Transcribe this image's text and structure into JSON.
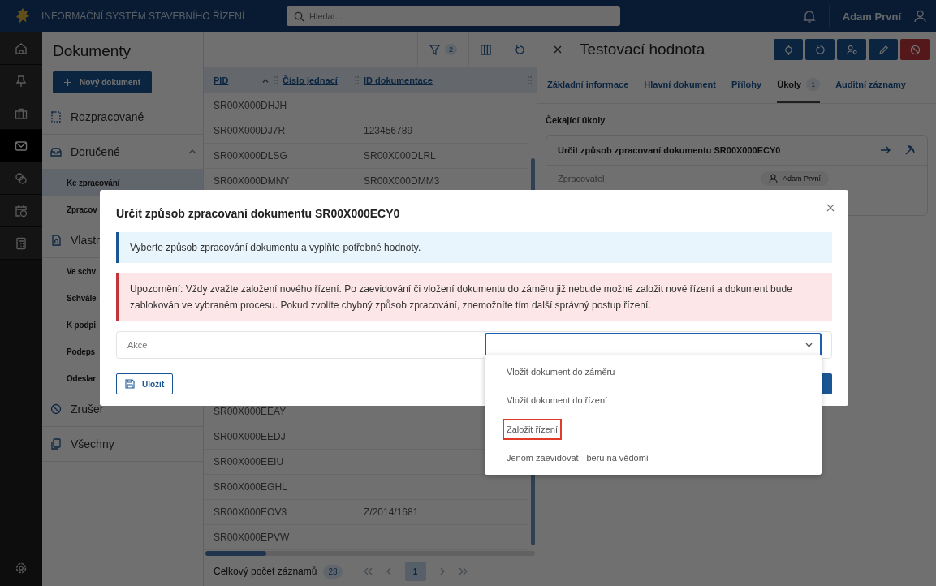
{
  "header": {
    "title": "INFORMAČNÍ SYSTÉM STAVEBNÍHO ŘÍZENÍ",
    "search": {
      "placeholder": "Hledat..."
    },
    "user": "Adam První"
  },
  "rail": [
    {
      "kind": "home",
      "selected": false
    },
    {
      "kind": "pin",
      "selected": false
    },
    {
      "kind": "briefcase",
      "selected": false
    },
    {
      "kind": "mail",
      "selected": true
    },
    {
      "kind": "coins",
      "selected": false
    },
    {
      "kind": "calendar",
      "selected": false
    },
    {
      "kind": "calculator",
      "selected": false
    }
  ],
  "sidebar": {
    "title": "Dokumenty",
    "new_button": "Nový dokument",
    "items": [
      {
        "kind": "draft",
        "label": "Rozpracované",
        "expanded": false
      },
      {
        "kind": "inbox",
        "label": "Doručené",
        "expanded": true,
        "children": [
          {
            "label": "Ke zpracování",
            "selected": true
          },
          {
            "label": "Zpracov",
            "selected": false
          }
        ]
      },
      {
        "kind": "own",
        "label": "Vlastn",
        "expanded": true,
        "children": [
          {
            "label": "Ve schv",
            "selected": false
          },
          {
            "label": "Schvále",
            "selected": false
          },
          {
            "label": "K podpi",
            "selected": false
          },
          {
            "label": "Podeps",
            "selected": false
          },
          {
            "label": "Odeslar",
            "selected": false
          }
        ]
      },
      {
        "kind": "cancelled",
        "label": "Zrušer",
        "expanded": false
      },
      {
        "kind": "all",
        "label": "Všechny",
        "expanded": false
      }
    ]
  },
  "table": {
    "filter_count": "2",
    "columns": [
      {
        "label": "PID",
        "sorted": true
      },
      {
        "label": "Číslo jednací",
        "sorted": false
      },
      {
        "label": "ID dokumentace",
        "sorted": false
      }
    ],
    "rows": [
      [
        "SR00X000DHJH",
        "",
        ""
      ],
      [
        "SR00X000DJ7R",
        "",
        "123456789"
      ],
      [
        "SR00X000DLSG",
        "",
        "SR00X000DLRL"
      ],
      [
        "SR00X000DMNY",
        "",
        "SR00X000DMM3"
      ],
      [
        "SR00X000EEAY",
        "",
        ""
      ],
      [
        "SR00X000EEDJ",
        "",
        ""
      ],
      [
        "SR00X000EEIU",
        "",
        ""
      ],
      [
        "SR00X000EGHL",
        "",
        ""
      ],
      [
        "SR00X000EOV3",
        "",
        "Z/2014/1681"
      ],
      [
        "SR00X000EPVW",
        "",
        ""
      ]
    ],
    "total_label": "Celkový počet záznamů",
    "total": "23",
    "pages": [
      {
        "label": "1",
        "selected": true
      }
    ]
  },
  "detail": {
    "title": "Testovací hodnota",
    "actions": [
      {
        "kind": "locate"
      },
      {
        "kind": "undo"
      },
      {
        "kind": "assign"
      },
      {
        "kind": "edit"
      },
      {
        "kind": "cancel"
      }
    ],
    "tabs": [
      {
        "label": "Základní informace",
        "selected": false
      },
      {
        "label": "Hlavní dokument",
        "selected": false
      },
      {
        "label": "Přílohy",
        "selected": false
      },
      {
        "label": "Úkoly",
        "selected": true,
        "badge": "1"
      },
      {
        "label": "Auditní záznamy",
        "selected": false
      }
    ],
    "section": "Čekající úkoly",
    "task": {
      "title": "Určit způsob zpracovaní dokumentu SR00X000ECY0",
      "field": "Zpracovatel",
      "value": "Adam První"
    }
  },
  "dialog": {
    "title": "Určit způsob zpracovaní dokumentu SR00X000ECY0",
    "info": "Vyberte způsob zpracování dokumentu a vyplňte potřebné hodnoty.",
    "warning": "Upozornění: Vždy zvažte založení nového řízení. Po zaevidování či vložení dokumentu do záměru již nebude možné založit nové řízení a dokument bude zablokován ve vybraném procesu. Pokud zvolíte chybný způsob zpracování, znemožníte tím další správný postup řízení.",
    "field_label": "Akce",
    "dropdown_open": true,
    "options": [
      {
        "label": "Vložit dokument do záměru",
        "highlighted": false
      },
      {
        "label": "Vložit dokument do řízení",
        "highlighted": false
      },
      {
        "label": "Založit řízení",
        "highlighted": true
      },
      {
        "label": "Jenom zaevidovat - beru na vědomí",
        "highlighted": false
      }
    ],
    "save_button": "Uložit"
  }
}
